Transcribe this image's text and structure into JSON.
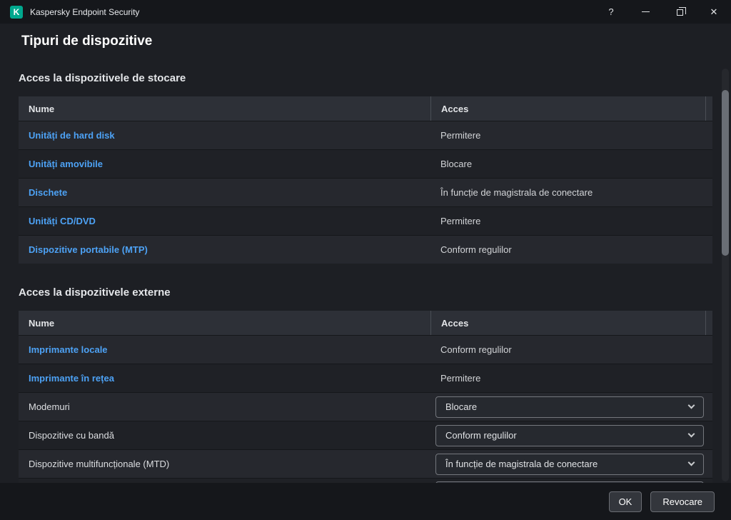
{
  "window": {
    "app_title": "Kaspersky Endpoint Security",
    "logo_letter": "K",
    "icons": {
      "help": "?",
      "close": "✕"
    }
  },
  "page": {
    "title": "Tipuri de dispozitive"
  },
  "colors": {
    "brand_green": "#00a88e",
    "link_blue": "#4da2f5"
  },
  "storage_section": {
    "heading": "Acces la dispozitivele de stocare",
    "columns": {
      "name": "Nume",
      "access": "Acces"
    },
    "rows": [
      {
        "name": "Unități de hard disk",
        "access": "Permitere"
      },
      {
        "name": "Unități amovibile",
        "access": "Blocare"
      },
      {
        "name": "Dischete",
        "access": "În funcție de magistrala de conectare"
      },
      {
        "name": "Unități CD/DVD",
        "access": "Permitere"
      },
      {
        "name": "Dispozitive portabile (MTP)",
        "access": "Conform regulilor"
      }
    ]
  },
  "external_section": {
    "heading": "Acces la dispozitivele externe",
    "columns": {
      "name": "Nume",
      "access": "Acces"
    },
    "rows": [
      {
        "name": "Imprimante locale",
        "access": "Conform regulilor"
      },
      {
        "name": "Imprimante în rețea",
        "access": "Permitere"
      },
      {
        "name": "Modemuri",
        "access": "Blocare"
      },
      {
        "name": "Dispozitive cu bandă",
        "access": "Conform regulilor"
      },
      {
        "name": "Dispozitive multifuncționale (MTD)",
        "access": "În funcție de magistrala de conectare"
      }
    ]
  },
  "footer": {
    "ok_label": "OK",
    "cancel_label": "Revocare"
  }
}
